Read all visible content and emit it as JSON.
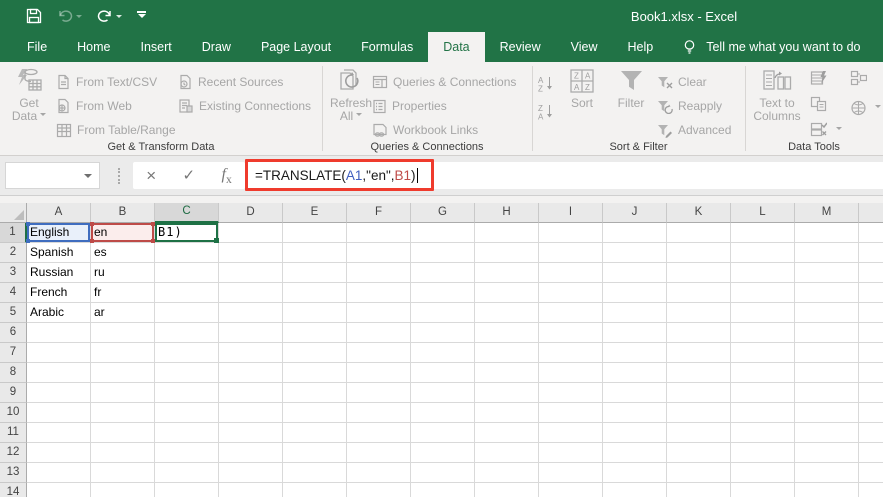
{
  "titlebar": {
    "title": "Book1.xlsx  -  Excel"
  },
  "qat_icons": [
    "save-icon",
    "undo-icon",
    "redo-icon",
    "customize-quick-access-toolbar-icon"
  ],
  "tabs": [
    {
      "label": "File",
      "active": false
    },
    {
      "label": "Home",
      "active": false
    },
    {
      "label": "Insert",
      "active": false
    },
    {
      "label": "Draw",
      "active": false
    },
    {
      "label": "Page Layout",
      "active": false
    },
    {
      "label": "Formulas",
      "active": false
    },
    {
      "label": "Data",
      "active": true
    },
    {
      "label": "Review",
      "active": false
    },
    {
      "label": "View",
      "active": false
    },
    {
      "label": "Help",
      "active": false
    }
  ],
  "tell_me": "Tell me what you want to do",
  "ribbon": {
    "groups": [
      {
        "label": "Get & Transform Data",
        "big": {
          "line1": "Get",
          "line2": "Data",
          "icon": "get-data-icon",
          "dropdown": true
        },
        "items": [
          {
            "label": "From Text/CSV",
            "icon": "text-csv-icon"
          },
          {
            "label": "From Web",
            "icon": "from-web-icon"
          },
          {
            "label": "From Table/Range",
            "icon": "table-range-icon"
          },
          {
            "label": "Recent Sources",
            "icon": "recent-sources-icon"
          },
          {
            "label": "Existing Connections",
            "icon": "existing-connections-icon"
          }
        ]
      },
      {
        "label": "Queries & Connections",
        "big": {
          "line1": "Refresh",
          "line2": "All",
          "icon": "refresh-all-icon",
          "dropdown": true
        },
        "items": [
          {
            "label": "Queries & Connections",
            "icon": "queries-connections-icon"
          },
          {
            "label": "Properties",
            "icon": "properties-icon"
          },
          {
            "label": "Workbook Links",
            "icon": "workbook-links-icon"
          }
        ]
      },
      {
        "label": "Sort & Filter",
        "sort_label": "Sort",
        "filter_label": "Filter",
        "items": [
          {
            "label": "Clear",
            "icon": "clear-filter-icon"
          },
          {
            "label": "Reapply",
            "icon": "reapply-filter-icon"
          },
          {
            "label": "Advanced",
            "icon": "advanced-filter-icon"
          }
        ]
      },
      {
        "label": "Data Tools",
        "big": {
          "line1": "Text to",
          "line2": "Columns",
          "icon": "text-to-columns-icon"
        },
        "tool_icons": [
          "flash-fill-icon",
          "remove-duplicates-icon",
          "data-validation-icon",
          "consolidate-icon",
          "data-model-icon"
        ]
      }
    ]
  },
  "formula_bar": {
    "name_box_value": "",
    "cancel_glyph": "×",
    "enter_glyph": "✓",
    "fx_label": "fx",
    "full_formula": "=TRANSLATE(A1,\"en\",B1)",
    "parts": [
      {
        "text": "=TRANSLATE(",
        "color": "#1a1a1a"
      },
      {
        "text": "A1",
        "color": "#3F5EBF"
      },
      {
        "text": ",\"en\",",
        "color": "#1a1a1a"
      },
      {
        "text": "B1",
        "color": "#BE4B48"
      },
      {
        "text": ")",
        "color": "#1a1a1a"
      }
    ]
  },
  "sheet": {
    "columns": [
      "A",
      "B",
      "C",
      "D",
      "E",
      "F",
      "G",
      "H",
      "I",
      "J",
      "K",
      "L",
      "M"
    ],
    "active_column": "C",
    "active_row": 1,
    "visible_rows": 14,
    "cells": {
      "A1": "English",
      "B1": "en",
      "C1": "B1)",
      "A2": "Spanish",
      "B2": "es",
      "A3": "Russian",
      "B3": "ru",
      "A4": "French",
      "B4": "fr",
      "A5": "Arabic",
      "B5": "ar"
    },
    "cell_styles": {
      "A1": "ref-blue",
      "B1": "ref-red",
      "C1": "cell-edit"
    }
  },
  "colors": {
    "excel_green": "#217346",
    "reference_blue": "#3F6DBF",
    "reference_red": "#BE4B48",
    "edit_cell_green": "#1E7145",
    "annotation_red": "#EF3B2D"
  }
}
